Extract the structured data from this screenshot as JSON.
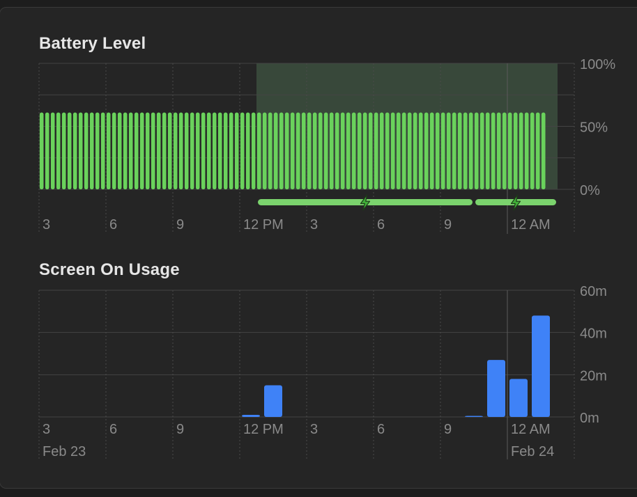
{
  "sections": {
    "battery": {
      "title": "Battery Level"
    },
    "usage": {
      "title": "Screen On Usage"
    }
  },
  "colors": {
    "battery_bar": "#6ad25c",
    "charging_band": "#38483a",
    "charging_bar": "#7bd36d",
    "charging_icon": "#3fae37",
    "usage_bar": "#3f82f7",
    "grid": "#444444",
    "label": "#8a8a8a"
  },
  "icons": {
    "charging": "lightning-bolt-icon"
  },
  "chart_data": [
    {
      "type": "bar",
      "title": "Battery Level",
      "x_start": "Feb 23 1 AM",
      "slot_minutes": 15,
      "y_unit": "%",
      "ylim": [
        0,
        100
      ],
      "y_ticks": [
        "100%",
        "50%",
        "0%"
      ],
      "x_tick_labels": [
        "3",
        "6",
        "9",
        "12 PM",
        "3",
        "6",
        "9",
        "12 AM"
      ],
      "values": [
        61,
        61,
        61,
        61,
        61,
        61,
        61,
        61,
        61,
        61,
        61,
        61,
        61,
        61,
        61,
        61,
        61,
        61,
        61,
        61,
        61,
        61,
        61,
        61,
        61,
        61,
        61,
        61,
        61,
        61,
        61,
        61,
        61,
        61,
        61,
        61,
        61,
        61,
        61,
        61,
        61,
        61,
        61,
        61,
        61,
        61,
        61,
        61,
        61,
        61,
        61,
        61,
        61,
        61,
        61,
        61,
        61,
        61,
        61,
        61,
        61,
        61,
        61,
        61,
        61,
        61,
        61,
        61,
        61,
        61,
        61,
        61,
        61,
        61,
        61,
        61,
        61,
        61,
        61,
        61,
        61,
        61,
        61,
        61,
        61,
        61,
        61,
        61,
        61,
        61,
        61
      ],
      "charging_periods": [
        {
          "start": "Feb 23 10:45 AM",
          "end": "Feb 23 8:30 PM"
        },
        {
          "start": "Feb 23 8:30 PM",
          "end": "Feb 24 12:15 AM"
        }
      ],
      "grid": true
    },
    {
      "type": "bar",
      "title": "Screen On Usage",
      "y_unit": "m",
      "ylim": [
        0,
        60
      ],
      "y_ticks": [
        "60m",
        "40m",
        "20m",
        "0m"
      ],
      "x_tick_labels": [
        "3",
        "6",
        "9",
        "12 PM",
        "3",
        "6",
        "9",
        "12 AM"
      ],
      "date_labels": [
        "Feb 23",
        "Feb 24"
      ],
      "bars": [
        {
          "hour": "10 AM",
          "minutes": 1
        },
        {
          "hour": "11 AM",
          "minutes": 15
        },
        {
          "hour": "8 PM",
          "minutes": 0.5
        },
        {
          "hour": "9 PM",
          "minutes": 27
        },
        {
          "hour": "10 PM",
          "minutes": 18
        },
        {
          "hour": "11 PM",
          "minutes": 48
        }
      ],
      "grid": true
    }
  ]
}
